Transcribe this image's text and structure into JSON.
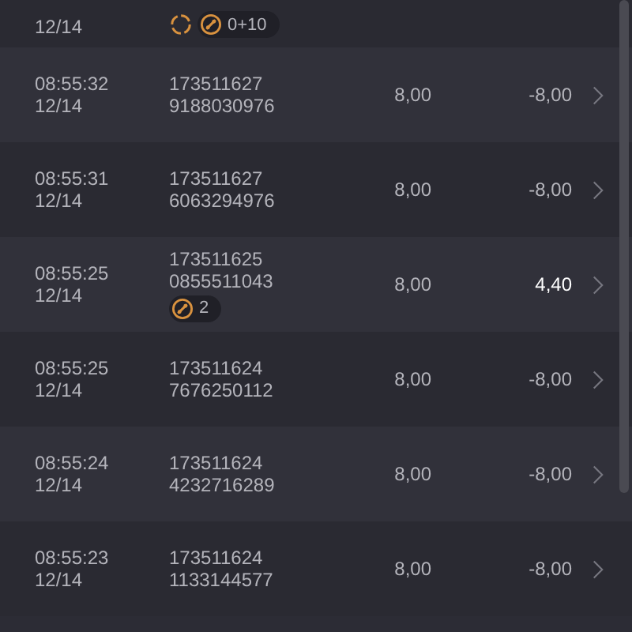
{
  "rows": [
    {
      "time": null,
      "date": "12/14",
      "id_lines": [],
      "amount": null,
      "result": null,
      "badges": [
        {
          "kind": "refresh"
        },
        {
          "kind": "coin",
          "count": "0+10"
        }
      ]
    },
    {
      "time": "08:55:32",
      "date": "12/14",
      "id_lines": [
        "173511627",
        "9188030976"
      ],
      "amount": "8,00",
      "result": "-8,00",
      "positive": false,
      "badges": []
    },
    {
      "time": "08:55:31",
      "date": "12/14",
      "id_lines": [
        "173511627",
        "6063294976"
      ],
      "amount": "8,00",
      "result": "-8,00",
      "positive": false,
      "badges": []
    },
    {
      "time": "08:55:25",
      "date": "12/14",
      "id_lines": [
        "173511625",
        "0855511043"
      ],
      "amount": "8,00",
      "result": "4,40",
      "positive": true,
      "badges": [
        {
          "kind": "coin",
          "count": "2"
        }
      ]
    },
    {
      "time": "08:55:25",
      "date": "12/14",
      "id_lines": [
        "173511624",
        "7676250112"
      ],
      "amount": "8,00",
      "result": "-8,00",
      "positive": false,
      "badges": []
    },
    {
      "time": "08:55:24",
      "date": "12/14",
      "id_lines": [
        "173511624",
        "4232716289"
      ],
      "amount": "8,00",
      "result": "-8,00",
      "positive": false,
      "badges": []
    },
    {
      "time": "08:55:23",
      "date": "12/14",
      "id_lines": [
        "173511624",
        "1133144577"
      ],
      "amount": "8,00",
      "result": "-8,00",
      "positive": false,
      "badges": []
    }
  ]
}
